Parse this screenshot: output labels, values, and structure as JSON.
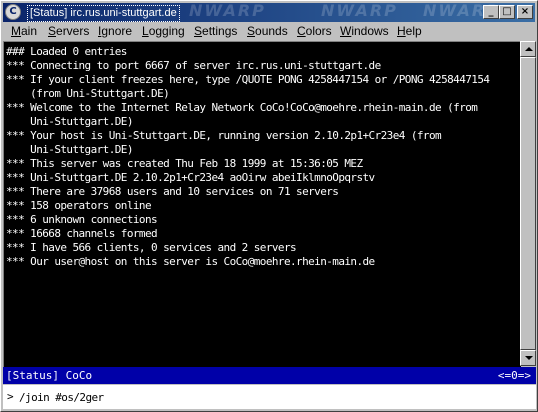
{
  "window": {
    "title": "[Status] irc.rus.uni-stuttgart.de",
    "app_icon": "ircle-icon",
    "watermark": "NWARP",
    "buttons": {
      "minimize": "_",
      "maximize": "□",
      "close": "×"
    }
  },
  "menu": [
    {
      "label": "Main"
    },
    {
      "label": "Servers"
    },
    {
      "label": "Ignore"
    },
    {
      "label": "Logging"
    },
    {
      "label": "Settings"
    },
    {
      "label": "Sounds"
    },
    {
      "label": "Colors"
    },
    {
      "label": "Windows"
    },
    {
      "label": "Help"
    }
  ],
  "output_lines": [
    "### Loaded 0 entries",
    "*** Connecting to port 6667 of server irc.rus.uni-stuttgart.de",
    "*** If your client freezes here, type /QUOTE PONG 4258447154 or /PONG 4258447154",
    "    (from Uni-Stuttgart.DE)",
    "*** Welcome to the Internet Relay Network CoCo!CoCo@moehre.rhein-main.de (from",
    "    Uni-Stuttgart.DE)",
    "*** Your host is Uni-Stuttgart.DE, running version 2.10.2p1+Cr23e4 (from",
    "    Uni-Stuttgart.DE)",
    "*** This server was created Thu Feb 18 1999 at 15:36:05 MEZ",
    "*** Uni-Stuttgart.DE 2.10.2p1+Cr23e4 aoOirw abeiIklmnoOpqrstv",
    "*** There are 37968 users and 10 services on 71 servers",
    "*** 158 operators online",
    "*** 6 unknown connections",
    "*** 16668 channels formed",
    "*** I have 566 clients, 0 services and 2 servers",
    "*** Our user@host on this server is CoCo@moehre.rhein-main.de"
  ],
  "status_bar": {
    "left": "[Status] CoCo",
    "right": "<=0=>"
  },
  "input": {
    "prompt": ">",
    "value": "/join #os/2ger"
  },
  "colors": {
    "output_bg": "#000000",
    "output_fg": "#ffffff",
    "status_bg": "#0000a8"
  }
}
